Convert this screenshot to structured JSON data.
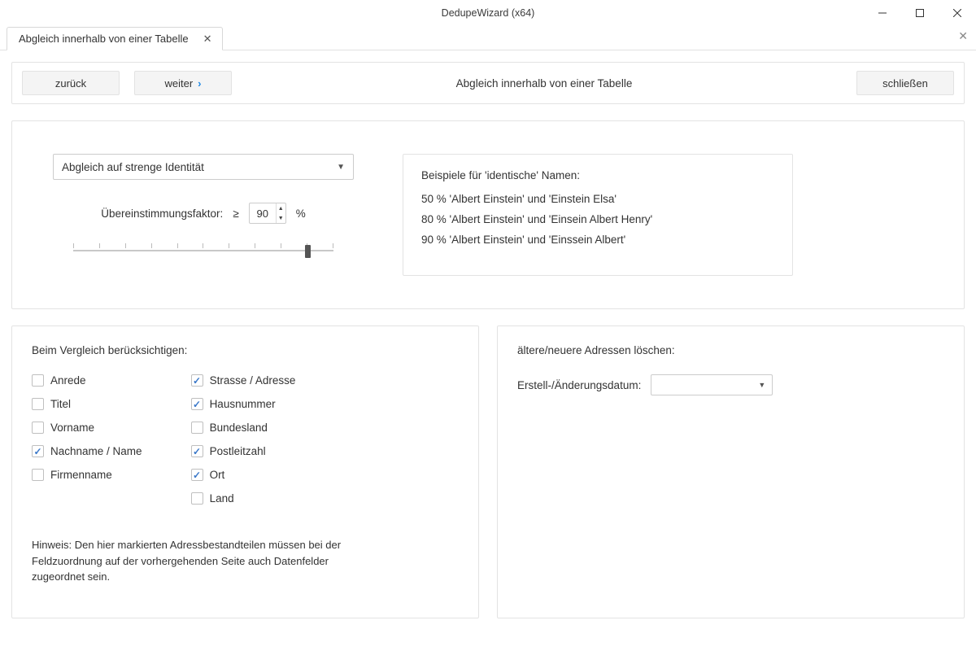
{
  "window": {
    "title": "DedupeWizard  (x64)"
  },
  "tab": {
    "label": "Abgleich innerhalb von einer Tabelle"
  },
  "toolbar": {
    "back": "zurück",
    "forward": "weiter",
    "title": "Abgleich innerhalb von einer Tabelle",
    "close": "schließen"
  },
  "match": {
    "dropdown": "Abgleich auf strenge Identität",
    "factor_label": "Übereinstimmungsfaktor:",
    "gte": "≥",
    "factor_value": "90",
    "percent": "%"
  },
  "examples": {
    "title": "Beispiele für 'identische' Namen:",
    "rows": [
      "50 %   'Albert Einstein' und 'Einstein Elsa'",
      "80 %   'Albert Einstein' und 'Einsein Albert Henry'",
      "90 %   'Albert Einstein' und 'Einssein Albert'"
    ]
  },
  "compare": {
    "title": "Beim Vergleich berücksichtigen:",
    "col1": [
      {
        "label": "Anrede",
        "checked": false
      },
      {
        "label": "Titel",
        "checked": false
      },
      {
        "label": "Vorname",
        "checked": false
      },
      {
        "label": "Nachname / Name",
        "checked": true
      },
      {
        "label": "Firmenname",
        "checked": false
      }
    ],
    "col2": [
      {
        "label": "Strasse / Adresse",
        "checked": true
      },
      {
        "label": "Hausnummer",
        "checked": true
      },
      {
        "label": "Bundesland",
        "checked": false
      },
      {
        "label": "Postleitzahl",
        "checked": true
      },
      {
        "label": "Ort",
        "checked": true
      },
      {
        "label": "Land",
        "checked": false
      }
    ],
    "hint": "Hinweis: Den hier markierten Adressbestandteilen müssen bei der Feldzuordnung auf der vorhergehenden Seite auch Datenfelder zugeordnet sein."
  },
  "delete_addr": {
    "title": "ältere/neuere Adressen löschen:",
    "date_label": "Erstell-/Änderungsdatum:",
    "date_value": ""
  }
}
